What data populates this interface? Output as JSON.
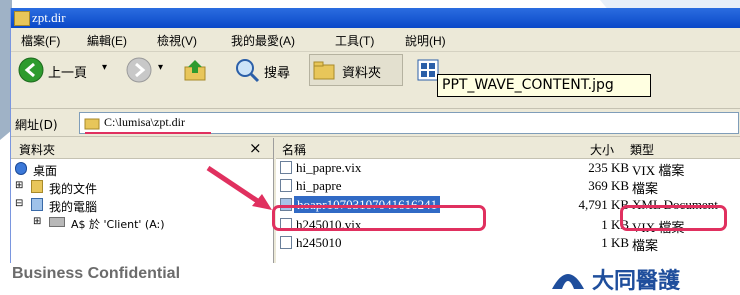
{
  "window": {
    "title": "zpt.dir",
    "menu": [
      "檔案(F)",
      "編輯(E)",
      "檢視(V)",
      "我的最愛(A)",
      "工具(T)",
      "說明(H)"
    ]
  },
  "toolbar": {
    "back_label": "上一頁",
    "search_label": "搜尋",
    "folders_label": "資料夾"
  },
  "tooltip": "PPT_WAVE_CONTENT.jpg",
  "address": {
    "label": "網址(D)",
    "path": "C:\\lumisa\\zpt.dir"
  },
  "folder_pane": {
    "title": "資料夾",
    "close": "×",
    "items": [
      {
        "label": "桌面",
        "icon": "desktop-icon"
      },
      {
        "label": "我的文件",
        "icon": "documents-icon"
      },
      {
        "label": "我的電腦",
        "icon": "computer-icon"
      },
      {
        "label": "A$ 於 'Client' (A:)",
        "icon": "drive-icon"
      }
    ]
  },
  "list": {
    "headers": {
      "name": "名稱",
      "size": "大小",
      "type": "類型"
    },
    "rows": [
      {
        "name": "hi_papre.vix",
        "size": "235 KB",
        "type": "VIX 檔案"
      },
      {
        "name": "hi_papre",
        "size": "369 KB",
        "type": "檔案"
      },
      {
        "name": "hoapr10703107041616241",
        "size": "4,791 KB",
        "type": "XML Document"
      },
      {
        "name": "h245010.vix",
        "size": "1 KB",
        "type": "VIX 檔案"
      },
      {
        "name": "h245010",
        "size": "1 KB",
        "type": "檔案"
      }
    ]
  },
  "footer": {
    "confidential": "Business Confidential",
    "brand": "大同醫護"
  },
  "colors": {
    "highlight": "#e0305f",
    "titlebar": "#0a48c8",
    "selection": "#316ac5"
  }
}
